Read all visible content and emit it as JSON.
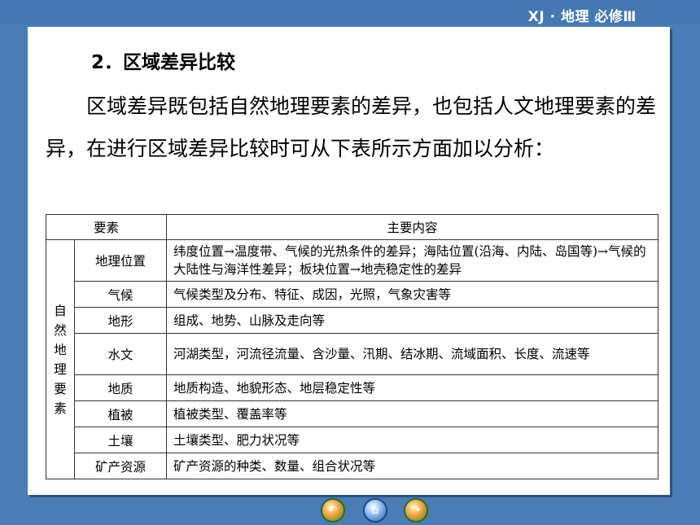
{
  "header": {
    "tag": "XJ · 地理  必修Ⅲ"
  },
  "section": {
    "title": "2．区域差异比较",
    "intro": "区域差异既包括自然地理要素的差异，也包括人文地理要素的差异，在进行区域差异比较时可从下表所示方面加以分析："
  },
  "table": {
    "headers": [
      "要素",
      "主要内容"
    ],
    "category": "自然地理要素",
    "rows": [
      {
        "name": "地理位置",
        "content": "纬度位置→温度带、气候的光热条件的差异；海陆位置(沿海、内陆、岛国等)→气候的大陆性与海洋性差异；板块位置→地壳稳定性的差异"
      },
      {
        "name": "气候",
        "content": "气候类型及分布、特征、成因，光照，气象灾害等"
      },
      {
        "name": "地形",
        "content": "组成、地势、山脉及走向等"
      },
      {
        "name": "水文",
        "content": "河湖类型，河流径流量、含沙量、汛期、结冰期、流域面积、长度、流速等"
      },
      {
        "name": "地质",
        "content": "地质构造、地貌形态、地层稳定性等"
      },
      {
        "name": "植被",
        "content": "植被类型、覆盖率等"
      },
      {
        "name": "土壤",
        "content": "土壤类型、肥力状况等"
      },
      {
        "name": "矿产资源",
        "content": "矿产资源的种类、数量、组合状况等"
      }
    ]
  },
  "nav": {
    "prev_icon": "back-arrow-icon",
    "home_icon": "home-icon",
    "next_icon": "forward-arrow-icon"
  }
}
